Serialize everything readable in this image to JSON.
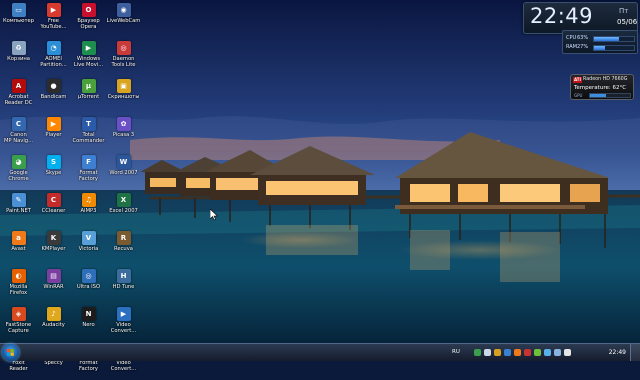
{
  "desktop": {
    "icons": [
      {
        "label": "Компьютер",
        "color": "#3f7fc4",
        "glyph": "▭",
        "icon": "computer-icon"
      },
      {
        "label": "Free\nYouTube...",
        "color": "#d83a2e",
        "glyph": "▶",
        "icon": "youtube-downloader-icon"
      },
      {
        "label": "Браузер\nOpera",
        "color": "#c8102e",
        "glyph": "O",
        "icon": "opera-icon"
      },
      {
        "label": "LiveWebCam",
        "color": "#3d5f9e",
        "glyph": "◉",
        "icon": "webcam-icon"
      },
      {
        "label": "Корзина",
        "color": "#8aa4c0",
        "glyph": "♻",
        "icon": "recycle-bin-icon"
      },
      {
        "label": "AOMEI\nPartition...",
        "color": "#2b8fd8",
        "glyph": "◔",
        "icon": "partition-tool-icon"
      },
      {
        "label": "Windows\nLive Movi...",
        "color": "#1e8e4e",
        "glyph": "▶",
        "icon": "movie-maker-icon"
      },
      {
        "label": "Daemon\nTools Lite",
        "color": "#c93a3a",
        "glyph": "◎",
        "icon": "disc-icon"
      },
      {
        "label": "Acrobat\nReader DC",
        "color": "#b30b0b",
        "glyph": "A",
        "icon": "acrobat-icon"
      },
      {
        "label": "Bandicam",
        "color": "#2c2c2c",
        "glyph": "●",
        "icon": "bandicam-icon"
      },
      {
        "label": "µTorrent",
        "color": "#4aa03a",
        "glyph": "µ",
        "icon": "torrent-icon"
      },
      {
        "label": "Скриншоты",
        "color": "#d9a520",
        "glyph": "▣",
        "icon": "folder-icon"
      },
      {
        "label": "Canon\nMP Navig...",
        "color": "#3367b0",
        "glyph": "C",
        "icon": "printer-icon"
      },
      {
        "label": "Player",
        "color": "#ff8800",
        "glyph": "▶",
        "icon": "player-icon"
      },
      {
        "label": "Total\nCommander",
        "color": "#2a5aa8",
        "glyph": "T",
        "icon": "file-manager-icon"
      },
      {
        "label": "Picasa 3",
        "color": "#6a4fc7",
        "glyph": "✿",
        "icon": "picasa-icon"
      },
      {
        "label": "Google\nChrome",
        "color": "#3a9f4a",
        "glyph": "◕",
        "icon": "chrome-icon"
      },
      {
        "label": "Skype",
        "color": "#00aff0",
        "glyph": "S",
        "icon": "skype-icon"
      },
      {
        "label": "Format\nFactory",
        "color": "#3d7fd0",
        "glyph": "F",
        "icon": "format-factory-icon"
      },
      {
        "label": "Word 2007",
        "color": "#2b579a",
        "glyph": "W",
        "icon": "word-icon"
      },
      {
        "label": "Paint.NET",
        "color": "#4b8fd4",
        "glyph": "✎",
        "icon": "paint-icon"
      },
      {
        "label": "CCleaner",
        "color": "#c42b2b",
        "glyph": "C",
        "icon": "ccleaner-icon"
      },
      {
        "label": "AIMP3",
        "color": "#f08a00",
        "glyph": "♫",
        "icon": "aimp-icon"
      },
      {
        "label": "Excel 2007",
        "color": "#1f7244",
        "glyph": "X",
        "icon": "excel-icon"
      },
      {
        "label": "Avast",
        "color": "#f07a1a",
        "glyph": "a",
        "icon": "avast-icon"
      },
      {
        "label": "KMPlayer",
        "color": "#3a3a3a",
        "glyph": "K",
        "icon": "kmplayer-icon"
      },
      {
        "label": "Victoria",
        "color": "#5aa0d8",
        "glyph": "V",
        "icon": "victoria-icon"
      },
      {
        "label": "Recuva",
        "color": "#7a5a2e",
        "glyph": "R",
        "icon": "recuva-icon"
      },
      {
        "label": "Mozilla\nFirefox",
        "color": "#e66000",
        "glyph": "◐",
        "icon": "firefox-icon"
      },
      {
        "label": "WinRAR",
        "color": "#7b3fa0",
        "glyph": "▤",
        "icon": "winrar-icon"
      },
      {
        "label": "Ultra ISO",
        "color": "#2f6eb8",
        "glyph": "◎",
        "icon": "ultraiso-icon"
      },
      {
        "label": "HD Tune",
        "color": "#3c6b9e",
        "glyph": "H",
        "icon": "hdtune-icon"
      },
      {
        "label": "FastStone\nCapture",
        "color": "#d84a1e",
        "glyph": "◈",
        "icon": "faststone-icon"
      },
      {
        "label": "Audacity",
        "color": "#e0a81c",
        "glyph": "♪",
        "icon": "audacity-icon"
      },
      {
        "label": "Nero",
        "color": "#1c1c1c",
        "glyph": "N",
        "icon": "nero-icon"
      },
      {
        "label": "Video\nConvert...",
        "color": "#2a6fc0",
        "glyph": "▶",
        "icon": "video-converter-icon"
      },
      {
        "label": "Foxit\nReader",
        "color": "#d8381f",
        "glyph": "F",
        "icon": "foxit-icon"
      },
      {
        "label": "Speccy",
        "color": "#3e8a3e",
        "glyph": "S",
        "icon": "speccy-icon"
      },
      {
        "label": "Format\nFactory",
        "color": "#3a78c8",
        "glyph": "F",
        "icon": "format-factory-2-icon"
      },
      {
        "label": "Video\nConvert...",
        "color": "#5a5a9e",
        "glyph": "V",
        "icon": "video-converter-2-icon"
      }
    ]
  },
  "gadgets": {
    "clock": {
      "time": "22:49",
      "day": "Пт",
      "date": "05/06"
    },
    "meter": {
      "rows": [
        {
          "name": "CPU",
          "value": "63%",
          "fraction": 0.63
        },
        {
          "name": "RAM",
          "value": "27%",
          "fraction": 0.27
        }
      ]
    },
    "gpu": {
      "brand": "ATI",
      "name": "Radeon HD 7660G",
      "temperature": "Temperature: 62°C",
      "load_label": "GPU",
      "load_fraction": 0.4
    }
  },
  "taskbar": {
    "language": "RU",
    "time": "22:49",
    "tray_icons": [
      {
        "icon": "network-icon",
        "color": "#3a9f4a"
      },
      {
        "icon": "volume-icon",
        "color": "#cfd8e6"
      },
      {
        "icon": "security-icon",
        "color": "#d8a020"
      },
      {
        "icon": "sync-icon",
        "color": "#3a80d0"
      },
      {
        "icon": "antivirus-icon",
        "color": "#f07a1a"
      },
      {
        "icon": "record-icon",
        "color": "#c83232"
      },
      {
        "icon": "power-icon",
        "color": "#6fbf3a"
      },
      {
        "icon": "update-icon",
        "color": "#5ab0e8"
      },
      {
        "icon": "cloud-icon",
        "color": "#8ab4e0"
      },
      {
        "icon": "flag-icon",
        "color": "#e6e6e6"
      }
    ]
  }
}
